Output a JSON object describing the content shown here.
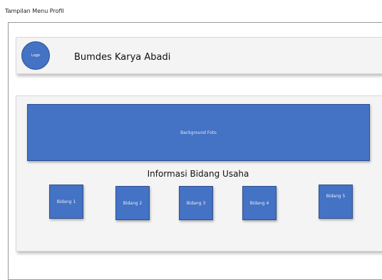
{
  "caption": "Tampilan Menu Profil",
  "header": {
    "logo_label": "Logo",
    "title": "Bumdes Karya Abadi"
  },
  "hero": {
    "label": "Background Foto"
  },
  "section": {
    "title": "Informasi Bidang Usaha"
  },
  "bidang": [
    {
      "label": "Bidang 1"
    },
    {
      "label": "Bidang 2"
    },
    {
      "label": "Bidang 3"
    },
    {
      "label": "Bidang 4"
    },
    {
      "label": "Bidang 5"
    }
  ],
  "colors": {
    "accent": "#4472c4",
    "accent_border": "#2f528f",
    "card_bg": "#f4f4f4"
  }
}
